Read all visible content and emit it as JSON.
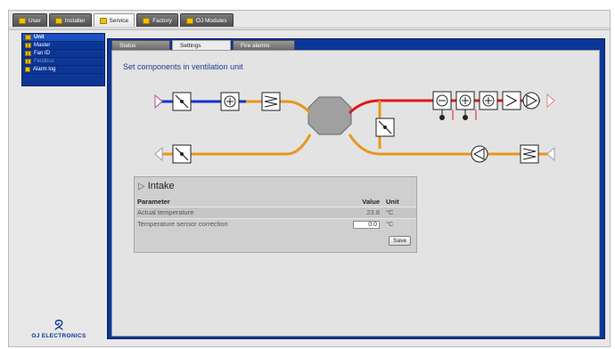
{
  "top_tabs": [
    {
      "label": "User",
      "active": false
    },
    {
      "label": "Installer",
      "active": false
    },
    {
      "label": "Service",
      "active": true
    },
    {
      "label": "Factory",
      "active": false
    },
    {
      "label": "OJ Modules",
      "active": false
    }
  ],
  "sidebar": {
    "items": [
      {
        "label": "Unit",
        "icon": "unit-icon"
      },
      {
        "label": "Master",
        "icon": "grid-icon"
      },
      {
        "label": "Fan ID",
        "icon": "grid-icon"
      },
      {
        "label": "Fieldbus",
        "icon": "grid-icon"
      },
      {
        "label": "Alarm log",
        "icon": "bell-icon"
      }
    ]
  },
  "logo": {
    "mark": "ᘝ",
    "text": "OJ ELECTRONICS"
  },
  "sub_tabs": [
    {
      "label": "Status"
    },
    {
      "label": "Settings"
    },
    {
      "label": "Fire alarms"
    }
  ],
  "content": {
    "title": "Set components in ventilation unit"
  },
  "intake": {
    "title": "Intake",
    "headers": {
      "parameter": "Parameter",
      "value": "Value",
      "unit": "Unit"
    },
    "rows": [
      {
        "parameter": "Actual temperature",
        "value": "23.8",
        "unit": "°C"
      },
      {
        "parameter": "Temperature sensor correction",
        "value": "0.0",
        "unit": "°C"
      }
    ],
    "save_label": "Save"
  },
  "colors": {
    "navy": "#0c3696",
    "duct_blue": "#1532c8",
    "duct_red": "#e01818",
    "duct_orange": "#e8961e"
  }
}
